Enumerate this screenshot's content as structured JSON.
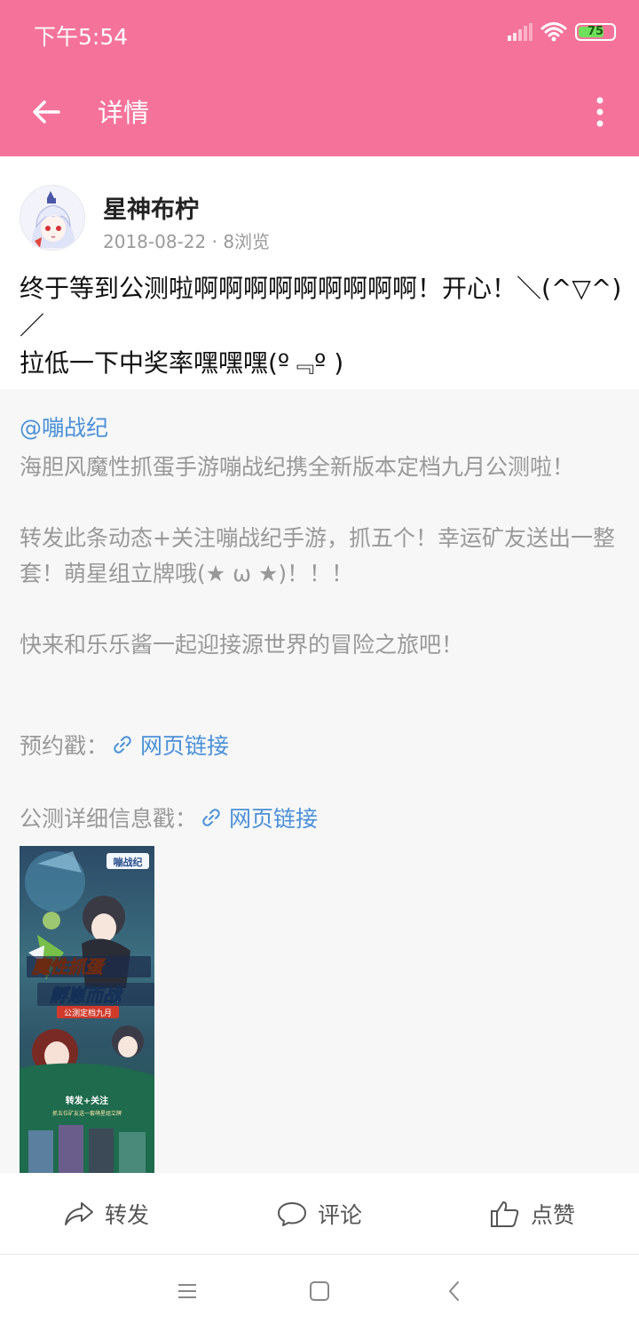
{
  "status_bar": {
    "time": "下午5:54",
    "battery": "75",
    "battery_level": 0.75
  },
  "app_bar": {
    "title": "详情"
  },
  "post": {
    "author": "星神布柠",
    "date": "2018-08-22",
    "views": "8浏览",
    "separator": " · ",
    "text": "终于等到公测啦啊啊啊啊啊啊啊啊啊！开心！＼(^▽^)／\n拉低一下中奖率嘿嘿嘿(º﹃º )"
  },
  "shared": {
    "mention": "@嘣战纪",
    "text": "海胆风魔性抓蛋手游嘣战纪携全新版本定档九月公测啦！\n\n转发此条动态+关注嘣战纪手游，抓五个！幸运矿友送出一整套！萌星组立牌哦(★ ω ★)！！！\n\n快来和乐乐酱一起迎接源世界的冒险之旅吧！",
    "links": [
      {
        "label": "预约戳：",
        "link_text": "网页链接"
      },
      {
        "label": "公测详细信息戳：",
        "link_text": "网页链接"
      }
    ],
    "poster": {
      "logo": "嘣战纪",
      "headline_1": "魔性抓蛋",
      "headline_2": "孵崽而战",
      "sub": "公测定档九月",
      "cta_1": "转发+关注",
      "cta_2": "抓五位矿友送一套萌星组立牌"
    }
  },
  "actions": {
    "share": "转发",
    "comment": "评论",
    "like": "点赞"
  }
}
